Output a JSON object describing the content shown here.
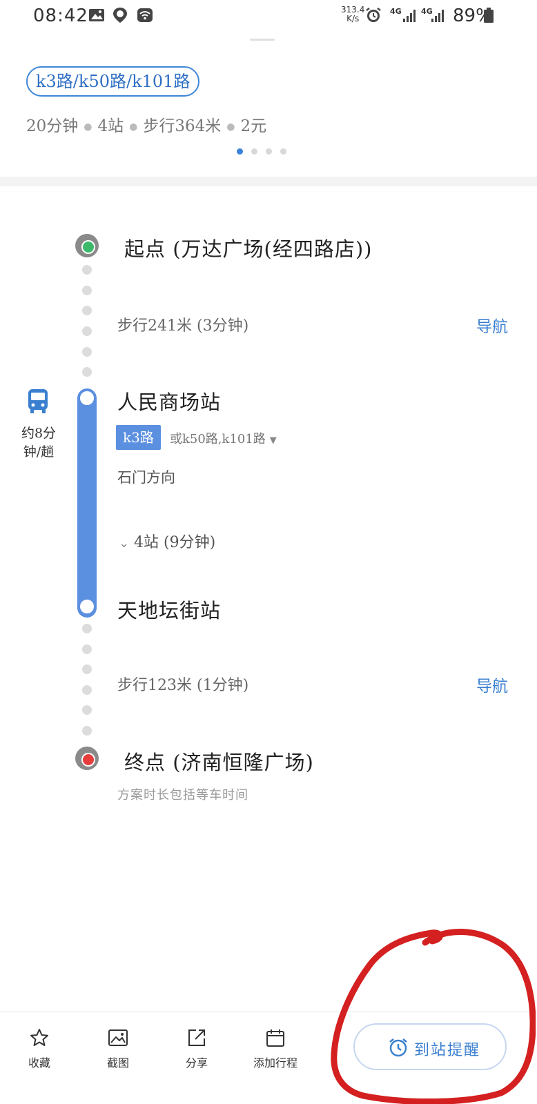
{
  "status_bar": {
    "time": "08:42",
    "net_speed_value": "313.4",
    "net_speed_unit": "K/s",
    "network_1": "4G",
    "network_2": "4G",
    "battery": "89%",
    "icons": [
      "image-icon",
      "location-app-icon",
      "wifi-icon",
      "alarm-icon",
      "signal-icon",
      "battery-icon"
    ]
  },
  "summary": {
    "route_label": "k3路/k50路/k101路",
    "duration": "20分钟",
    "stops": "4站",
    "walk": "步行364米",
    "fare": "2元",
    "page_count": 4,
    "active_page": 1
  },
  "timeline": {
    "start_label": "起点 (万达广场(经四路店))",
    "walk1": "步行241米 (3分钟)",
    "walk1_nav": "导航",
    "board_stop": "人民商场站",
    "bus_interval": "约8分钟/趟",
    "line": "k3路",
    "alt_lines": "或k50路,k101路",
    "direction": "石门方向",
    "ride_info": "4站 (9分钟)",
    "alight_stop": "天地坛街站",
    "walk2": "步行123米 (1分钟)",
    "walk2_nav": "导航",
    "end_label": "终点 (济南恒隆广场)",
    "note": "方案时长包括等车时间"
  },
  "toolbar": {
    "favorite": "收藏",
    "screenshot": "截图",
    "share": "分享",
    "add_trip": "添加行程",
    "arrival_reminder": "到站提醒"
  },
  "colors": {
    "accent": "#3a7fd0",
    "bus_line": "#5b8fe0",
    "start": "#3cb96a",
    "end": "#e53c3c",
    "annotation": "#d42020"
  }
}
